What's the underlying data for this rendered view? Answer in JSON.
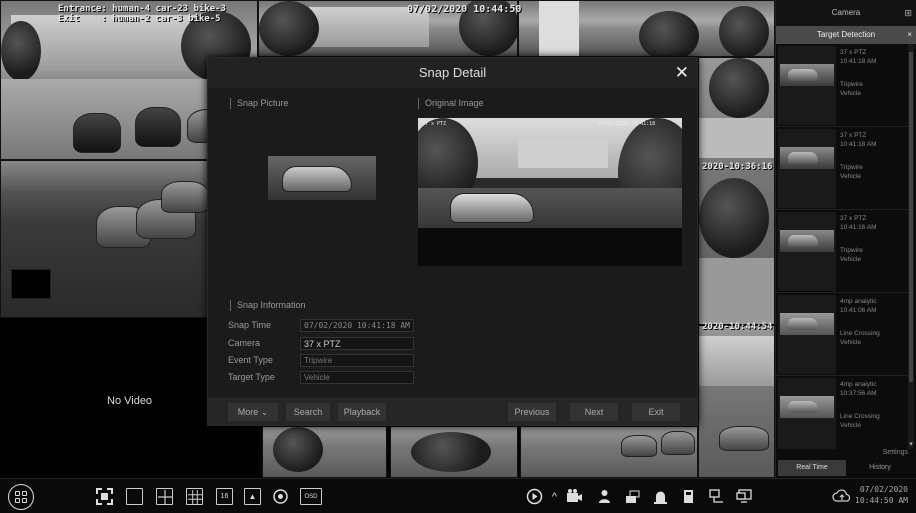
{
  "camera_grid": {
    "cam1_overlay_line1": "Entrance: human-4 car-23 bike-3",
    "cam1_overlay_line2": "Exit    : human-2 car-3 bike-5",
    "cam1_timestamp": "07/02/2020 10:44:50",
    "cam2_ts1": "2020-10:36:16",
    "cam2_ts2": "2020-10:44:54",
    "no_video_label": "No Video"
  },
  "side_panel": {
    "header": "Camera",
    "subheader": "Target Detection",
    "items": [
      {
        "camera": "37 x PTZ",
        "time": "10:41:18 AM",
        "event": "Tripwire",
        "target": "Vehicle"
      },
      {
        "camera": "37 x PTZ",
        "time": "10:41:18 AM",
        "event": "Tripwire",
        "target": "Vehicle"
      },
      {
        "camera": "37 x PTZ",
        "time": "10:41:16 AM",
        "event": "Tripwire",
        "target": "Vehicle"
      },
      {
        "camera": "4mp analytic",
        "time": "10:41:06 AM",
        "event": "Line Crossing",
        "target": "Vehicle"
      },
      {
        "camera": "4mp analytic",
        "time": "10:37:56 AM",
        "event": "Line Crossing",
        "target": "Vehicle"
      }
    ],
    "settings_label": "Settings",
    "tab_realtime": "Real Time",
    "tab_history": "History"
  },
  "modal": {
    "title": "Snap Detail",
    "snap_picture_label": "Snap Picture",
    "original_image_label": "Original Image",
    "snap_information_label": "Snap Information",
    "snap_time_label": "Snap Time",
    "snap_time_value": "07/02/2020 10:41:18 AM",
    "camera_label": "Camera",
    "camera_value": "37 x PTZ",
    "event_type_label": "Event Type",
    "event_type_value": "Tripwire",
    "target_type_label": "Target Type",
    "target_type_value": "Vehicle",
    "original_stamp_left": "37 x PTZ",
    "original_stamp_right": "07/02/2020 10:41:18",
    "buttons": {
      "more": "More",
      "search": "Search",
      "playback": "Playback",
      "previous": "Previous",
      "next": "Next",
      "exit": "Exit"
    }
  },
  "bottom_bar": {
    "osd_label": "OSD",
    "grid16_label": "16",
    "date": "07/02/2020",
    "time": "10:44:50 AM"
  }
}
